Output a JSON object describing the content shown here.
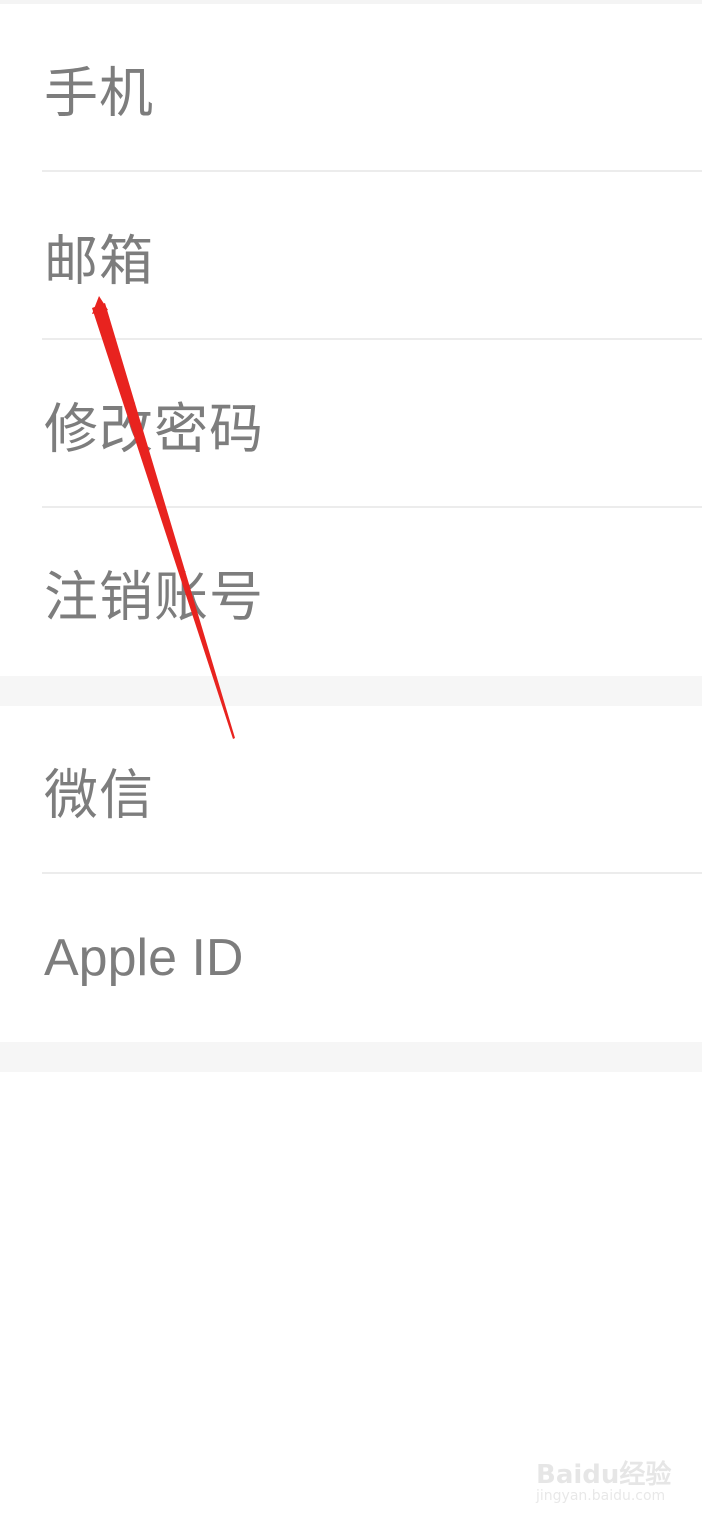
{
  "settings_list": {
    "group1": [
      {
        "label": "手机"
      },
      {
        "label": "邮箱"
      },
      {
        "label": "修改密码"
      },
      {
        "label": "注销账号"
      }
    ],
    "group2": [
      {
        "label": "微信"
      },
      {
        "label": "Apple ID"
      }
    ]
  },
  "annotation": {
    "arrow_color": "#e8231f",
    "target": "邮箱"
  },
  "watermark": {
    "logo_text": "Baidu经验",
    "url": "jingyan.baidu.com"
  },
  "colors": {
    "label_text": "#7d7d7d",
    "divider": "#ececec",
    "section_gap": "#f6f6f6"
  }
}
